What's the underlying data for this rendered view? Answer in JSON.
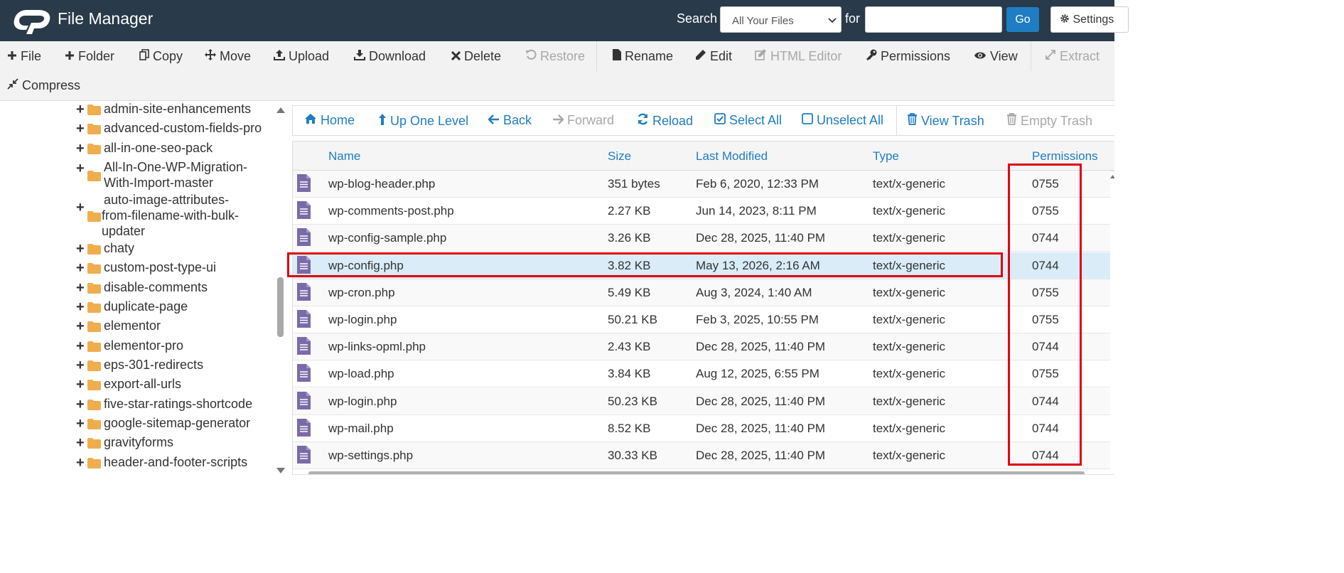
{
  "header": {
    "title": "File Manager",
    "search_label": "Search",
    "search_scope": "All Your Files",
    "for_label": "for",
    "search_value": "",
    "go_label": "Go",
    "settings_label": "Settings",
    "bg_color": "#293a4a",
    "accent_color": "#1f7dc4"
  },
  "toolbar": {
    "file": "File",
    "folder": "Folder",
    "copy": "Copy",
    "move": "Move",
    "upload": "Upload",
    "download": "Download",
    "delete": "Delete",
    "restore": "Restore",
    "rename": "Rename",
    "edit": "Edit",
    "html_editor": "HTML Editor",
    "permissions": "Permissions",
    "view": "View",
    "extract": "Extract",
    "compress": "Compress"
  },
  "tree": {
    "items": [
      {
        "label": "admin-site-enhancements"
      },
      {
        "label": "advanced-custom-fields-pro"
      },
      {
        "label": "all-in-one-seo-pack"
      },
      {
        "label_lines": [
          "All-In-One-WP-Migration-",
          "With-Import-master"
        ]
      },
      {
        "label_lines": [
          "auto-image-attributes-",
          "from-filename-with-bulk-",
          "updater"
        ]
      },
      {
        "label": "chaty"
      },
      {
        "label": "custom-post-type-ui"
      },
      {
        "label": "disable-comments"
      },
      {
        "label": "duplicate-page"
      },
      {
        "label": "elementor"
      },
      {
        "label": "elementor-pro"
      },
      {
        "label": "eps-301-redirects"
      },
      {
        "label": "export-all-urls"
      },
      {
        "label": "five-star-ratings-shortcode"
      },
      {
        "label": "google-sitemap-generator"
      },
      {
        "label": "gravityforms"
      },
      {
        "label": "header-and-footer-scripts"
      }
    ]
  },
  "nav": {
    "home": "Home",
    "up": "Up One Level",
    "back": "Back",
    "forward": "Forward",
    "reload": "Reload",
    "select_all": "Select All",
    "unselect_all": "Unselect All",
    "view_trash": "View Trash",
    "empty_trash": "Empty Trash"
  },
  "table": {
    "columns": {
      "name": "Name",
      "size": "Size",
      "modified": "Last Modified",
      "type": "Type",
      "permissions": "Permissions"
    },
    "rows": [
      {
        "name": "wp-blog-header.php",
        "size": "351 bytes",
        "modified": "Feb 6, 2020, 12:33 PM",
        "type": "text/x-generic",
        "perm": "0755"
      },
      {
        "name": "wp-comments-post.php",
        "size": "2.27 KB",
        "modified": "Jun 14, 2023, 8:11 PM",
        "type": "text/x-generic",
        "perm": "0755"
      },
      {
        "name": "wp-config-sample.php",
        "size": "3.26 KB",
        "modified": "Dec 28, 2025, 11:40 PM",
        "type": "text/x-generic",
        "perm": "0744"
      },
      {
        "name": "wp-config.php",
        "size": "3.82 KB",
        "modified": "May 13, 2026, 2:16 AM",
        "type": "text/x-generic",
        "perm": "0744",
        "selected": true
      },
      {
        "name": "wp-cron.php",
        "size": "5.49 KB",
        "modified": "Aug 3, 2024, 1:40 AM",
        "type": "text/x-generic",
        "perm": "0755"
      },
      {
        "name": "wp-login.php",
        "size": "50.21 KB",
        "modified": "Feb 3, 2025, 10:55 PM",
        "type": "text/x-generic",
        "perm": "0755"
      },
      {
        "name": "wp-links-opml.php",
        "size": "2.43 KB",
        "modified": "Dec 28, 2025, 11:40 PM",
        "type": "text/x-generic",
        "perm": "0744"
      },
      {
        "name": "wp-load.php",
        "size": "3.84 KB",
        "modified": "Aug 12, 2025, 6:55 PM",
        "type": "text/x-generic",
        "perm": "0755"
      },
      {
        "name": "wp-login.php",
        "size": "50.23 KB",
        "modified": "Dec 28, 2025, 11:40 PM",
        "type": "text/x-generic",
        "perm": "0744"
      },
      {
        "name": "wp-mail.php",
        "size": "8.52 KB",
        "modified": "Dec 28, 2025, 11:40 PM",
        "type": "text/x-generic",
        "perm": "0744"
      },
      {
        "name": "wp-settings.php",
        "size": "30.33 KB",
        "modified": "Dec 28, 2025, 11:40 PM",
        "type": "text/x-generic",
        "perm": "0744"
      }
    ]
  },
  "annotations": {
    "highlight_color": "#e0000f"
  }
}
